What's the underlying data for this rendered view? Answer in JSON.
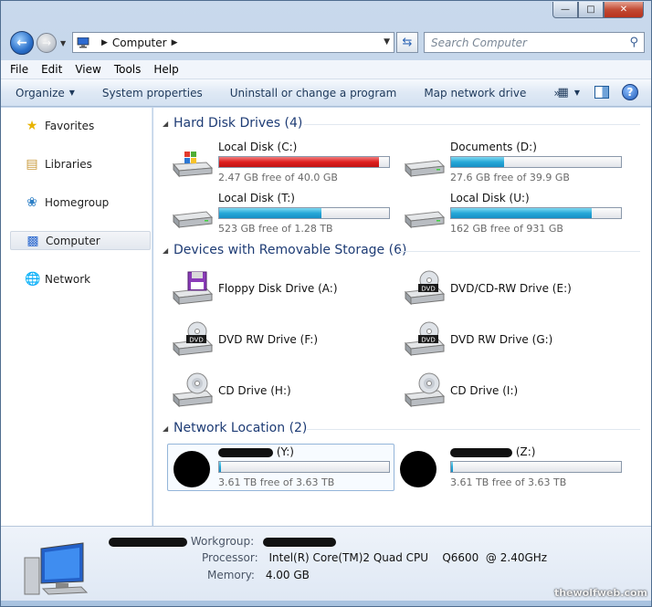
{
  "address": {
    "crumb": "Computer",
    "search_placeholder": "Search Computer"
  },
  "menu": [
    "File",
    "Edit",
    "View",
    "Tools",
    "Help"
  ],
  "commands": {
    "organize": "Organize",
    "system_properties": "System properties",
    "uninstall": "Uninstall or change a program",
    "map_drive": "Map network drive",
    "more": "»"
  },
  "nav": {
    "favorites": "Favorites",
    "libraries": "Libraries",
    "homegroup": "Homegroup",
    "computer": "Computer",
    "network": "Network"
  },
  "groups": {
    "hdd": "Hard Disk Drives (4)",
    "removable": "Devices with Removable Storage (6)",
    "network": "Network Location (2)"
  },
  "hard_drives": [
    {
      "name": "Local Disk (C:)",
      "free": "2.47 GB free of 40.0 GB",
      "used_fraction": 0.94,
      "bar_color": "#de1e1e"
    },
    {
      "name": "Documents (D:)",
      "free": "27.6 GB free of 39.9 GB",
      "used_fraction": 0.31,
      "bar_color": "#27a8d8"
    },
    {
      "name": "Local Disk (T:)",
      "free": "523 GB free of 1.28 TB",
      "used_fraction": 0.6,
      "bar_color": "#27a8d8"
    },
    {
      "name": "Local Disk (U:)",
      "free": "162 GB free of 931 GB",
      "used_fraction": 0.83,
      "bar_color": "#27a8d8"
    }
  ],
  "removable": [
    {
      "name": "Floppy Disk Drive (A:)",
      "icon": "floppy-icon"
    },
    {
      "name": "DVD/CD-RW Drive (E:)",
      "icon": "dvd-icon"
    },
    {
      "name": "DVD RW Drive (F:)",
      "icon": "dvd-icon"
    },
    {
      "name": "DVD RW Drive (G:)",
      "icon": "dvd-icon"
    },
    {
      "name": "CD Drive (H:)",
      "icon": "cd-icon"
    },
    {
      "name": "CD Drive (I:)",
      "icon": "cd-icon"
    }
  ],
  "network_locations": [
    {
      "name": "(Y:)",
      "free": "3.61 TB free of 3.63 TB",
      "used_fraction": 0.01
    },
    {
      "name": "(Z:)",
      "free": "3.61 TB free of 3.63 TB",
      "used_fraction": 0.01
    }
  ],
  "details": {
    "workgroup_label": "Workgroup:",
    "processor_label": "Processor:",
    "processor_value": "Intel(R) Core(TM)2 Quad CPU    Q6600  @ 2.40GHz",
    "memory_label": "Memory:",
    "memory_value": "4.00 GB"
  },
  "watermark": "thewolfweb.com"
}
